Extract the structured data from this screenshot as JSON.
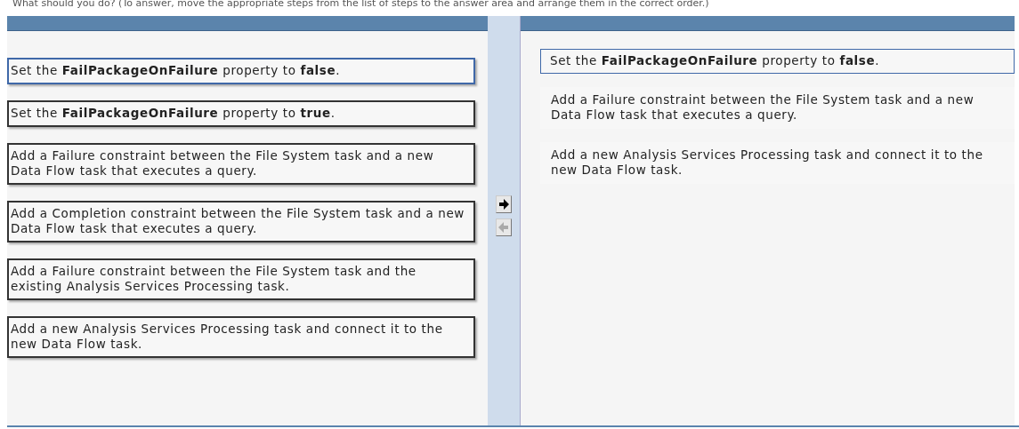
{
  "question": "What should you do? (To answer, move the appropriate steps from the list of steps to the answer area and arrange them in the correct order.)",
  "steps": [
    {
      "text": "Set the **FailPackageOnFailure** property to **false**.",
      "selected": true
    },
    {
      "text": "Set the **FailPackageOnFailure** property to **true**.",
      "selected": false
    },
    {
      "text": "Add a Failure constraint between the File System task and a new Data Flow task that executes a query.",
      "selected": false
    },
    {
      "text": "Add a Completion constraint between the File System task and a new Data Flow task that executes a query.",
      "selected": false
    },
    {
      "text": "Add a Failure constraint between the File System task and the existing Analysis Services Processing task.",
      "selected": false
    },
    {
      "text": "Add a new Analysis Services Processing task and connect it to the new Data Flow task.",
      "selected": false
    }
  ],
  "move_buttons": [
    {
      "kind": "right",
      "disabled": false
    },
    {
      "kind": "left",
      "disabled": true
    }
  ],
  "answer": [
    {
      "text": "Set the **FailPackageOnFailure** property to **false**.",
      "selected": true
    },
    {
      "text": "Add a Failure constraint between the File System task and a new Data Flow task that executes a query.",
      "selected": false
    },
    {
      "text": "Add a new Analysis Services Processing task and connect it to the new Data Flow task.",
      "selected": false
    }
  ]
}
